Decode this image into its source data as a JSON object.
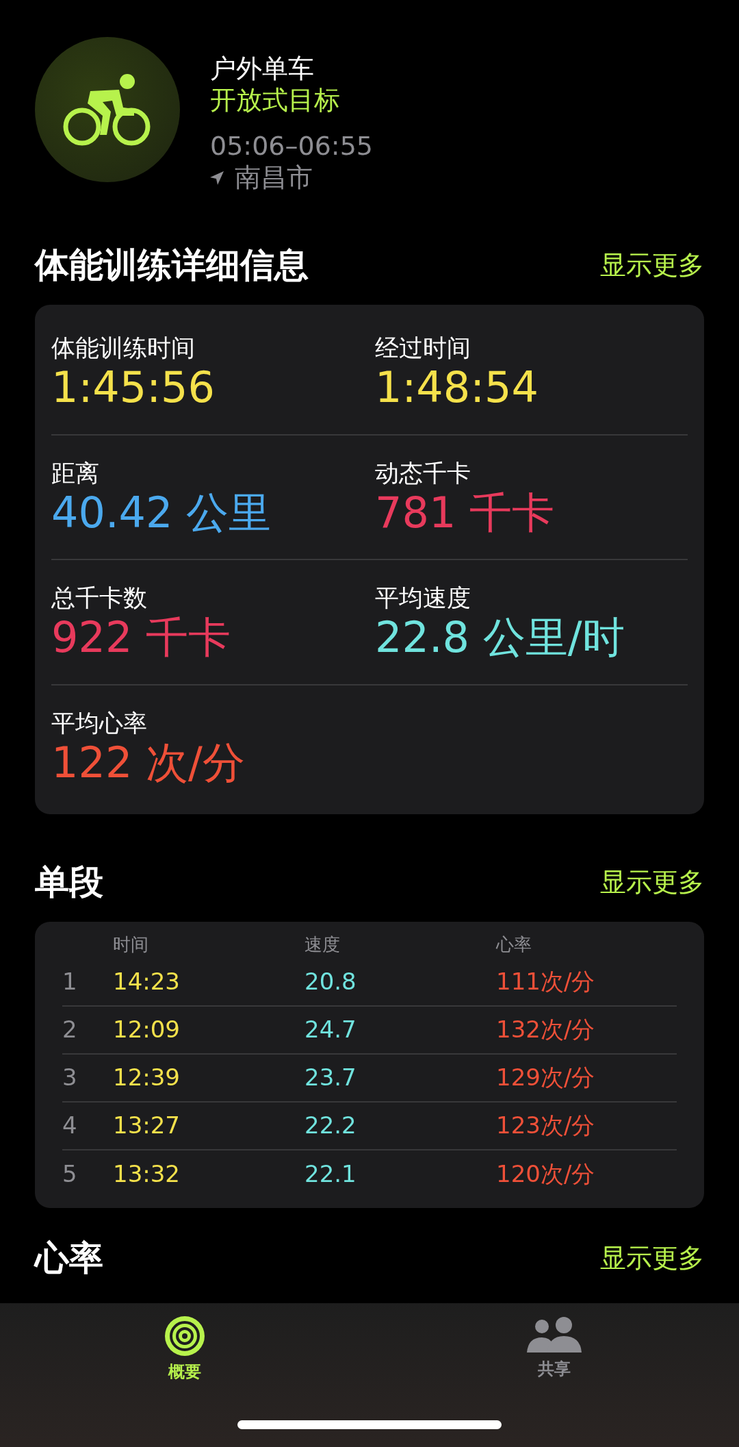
{
  "workout": {
    "title": "户外单车",
    "goal": "开放式目标",
    "time": "05:06–06:55",
    "location": "南昌市"
  },
  "details": {
    "heading": "体能训练详细信息",
    "more": "显示更多",
    "metrics": [
      {
        "label": "体能训练时间",
        "value": "1:45:56",
        "color": "#f5e14b"
      },
      {
        "label": "经过时间",
        "value": "1:48:54",
        "color": "#f5e14b"
      },
      {
        "label": "距离",
        "value": "40.42 公里",
        "color": "#4ba9ee"
      },
      {
        "label": "动态千卡",
        "value": "781 千卡",
        "color": "#e83a5c"
      },
      {
        "label": "总千卡数",
        "value": "922 千卡",
        "color": "#e83a5c"
      },
      {
        "label": "平均速度",
        "value": "22.8 公里/时",
        "color": "#70e3de"
      },
      {
        "label": "平均心率",
        "value": "122 次/分",
        "color": "#ef5038"
      }
    ]
  },
  "splits": {
    "heading": "单段",
    "more": "显示更多",
    "columns": [
      "",
      "时间",
      "速度",
      "心率"
    ],
    "rows": [
      [
        "1",
        "14:23",
        "20.8",
        "111次/分"
      ],
      [
        "2",
        "12:09",
        "24.7",
        "132次/分"
      ],
      [
        "3",
        "12:39",
        "23.7",
        "129次/分"
      ],
      [
        "4",
        "13:27",
        "22.2",
        "123次/分"
      ],
      [
        "5",
        "13:32",
        "22.1",
        "120次/分"
      ]
    ]
  },
  "heart_rate": {
    "heading": "心率",
    "more": "显示更多"
  },
  "tab_bar": [
    {
      "label": "概要",
      "selected": true
    },
    {
      "label": "共享",
      "selected": false
    }
  ]
}
